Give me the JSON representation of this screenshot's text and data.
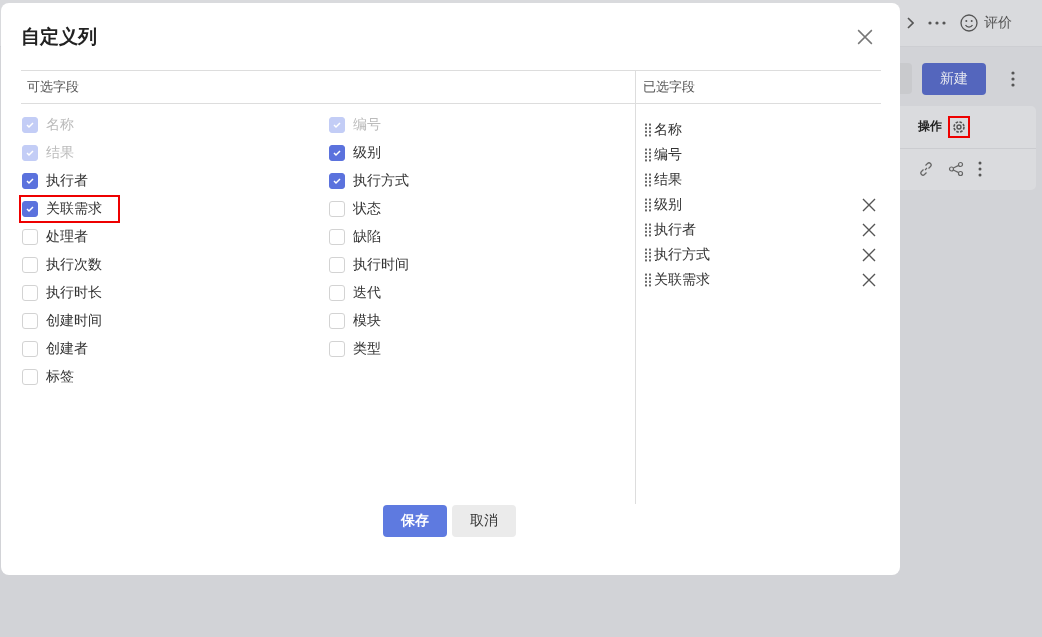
{
  "background_page": {
    "header": {
      "review_label": "评价"
    },
    "toolbar": {
      "new_button": "新建"
    },
    "table": {
      "column_header": "操作",
      "settings_highlighted": true
    }
  },
  "dialog": {
    "title": "自定义列",
    "available_fields": {
      "heading": "可选字段",
      "left_column": [
        {
          "label": "名称",
          "checked": true,
          "disabled": true,
          "highlighted": false
        },
        {
          "label": "结果",
          "checked": true,
          "disabled": true,
          "highlighted": false
        },
        {
          "label": "执行者",
          "checked": true,
          "disabled": false,
          "highlighted": false
        },
        {
          "label": "关联需求",
          "checked": true,
          "disabled": false,
          "highlighted": true
        },
        {
          "label": "处理者",
          "checked": false,
          "disabled": false,
          "highlighted": false
        },
        {
          "label": "执行次数",
          "checked": false,
          "disabled": false,
          "highlighted": false
        },
        {
          "label": "执行时长",
          "checked": false,
          "disabled": false,
          "highlighted": false
        },
        {
          "label": "创建时间",
          "checked": false,
          "disabled": false,
          "highlighted": false
        },
        {
          "label": "创建者",
          "checked": false,
          "disabled": false,
          "highlighted": false
        },
        {
          "label": "标签",
          "checked": false,
          "disabled": false,
          "highlighted": false
        }
      ],
      "right_column": [
        {
          "label": "编号",
          "checked": true,
          "disabled": true,
          "highlighted": false
        },
        {
          "label": "级别",
          "checked": true,
          "disabled": false,
          "highlighted": false
        },
        {
          "label": "执行方式",
          "checked": true,
          "disabled": false,
          "highlighted": false
        },
        {
          "label": "状态",
          "checked": false,
          "disabled": false,
          "highlighted": false
        },
        {
          "label": "缺陷",
          "checked": false,
          "disabled": false,
          "highlighted": false
        },
        {
          "label": "执行时间",
          "checked": false,
          "disabled": false,
          "highlighted": false
        },
        {
          "label": "迭代",
          "checked": false,
          "disabled": false,
          "highlighted": false
        },
        {
          "label": "模块",
          "checked": false,
          "disabled": false,
          "highlighted": false
        },
        {
          "label": "类型",
          "checked": false,
          "disabled": false,
          "highlighted": false
        }
      ]
    },
    "selected_fields": {
      "heading": "已选字段",
      "items": [
        {
          "label": "名称",
          "removable": false
        },
        {
          "label": "编号",
          "removable": false
        },
        {
          "label": "结果",
          "removable": false
        },
        {
          "label": "级别",
          "removable": true
        },
        {
          "label": "执行者",
          "removable": true
        },
        {
          "label": "执行方式",
          "removable": true
        },
        {
          "label": "关联需求",
          "removable": true
        }
      ]
    },
    "buttons": [
      {
        "label": "保存",
        "kind": "primary"
      },
      {
        "label": "取消",
        "kind": "secondary"
      }
    ]
  }
}
